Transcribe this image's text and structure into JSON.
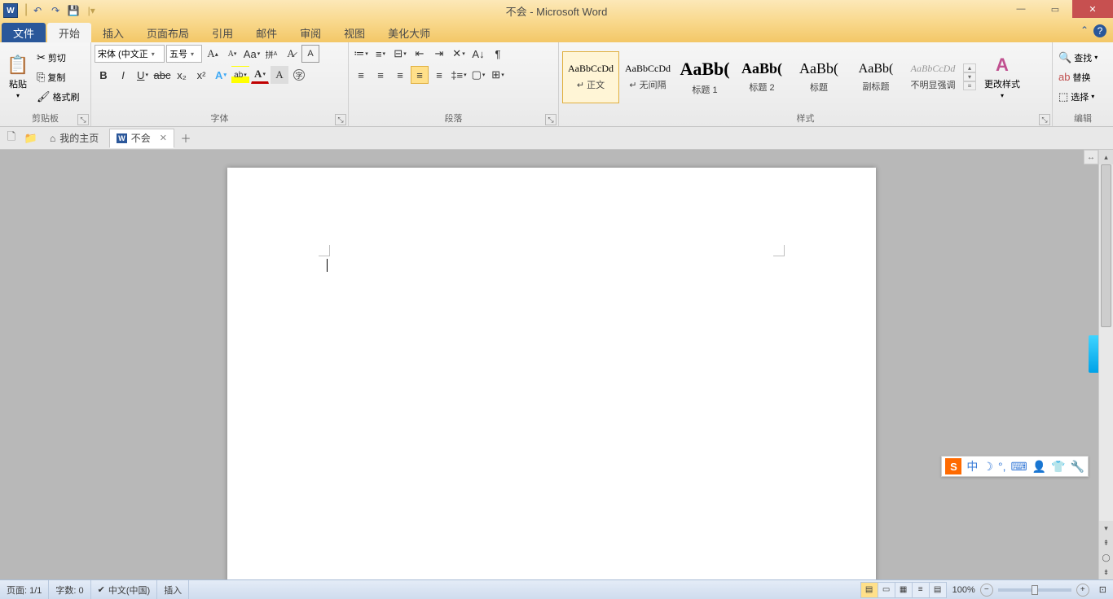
{
  "title": "不会 - Microsoft Word",
  "qat": {
    "undo": "↶",
    "redo": "↷",
    "save": "💾"
  },
  "win": {
    "min": "—",
    "max": "▭",
    "close": "✕"
  },
  "tabs": {
    "file": "文件",
    "items": [
      "开始",
      "插入",
      "页面布局",
      "引用",
      "邮件",
      "审阅",
      "视图",
      "美化大师"
    ],
    "active": 0
  },
  "ribbon": {
    "clipboard": {
      "label": "剪贴板",
      "paste": "粘贴",
      "cut": "剪切",
      "copy": "复制",
      "format_painter": "格式刷"
    },
    "font": {
      "label": "字体",
      "name": "宋体 (中文正",
      "size": "五号"
    },
    "paragraph": {
      "label": "段落"
    },
    "styles": {
      "label": "样式",
      "change": "更改样式",
      "items": [
        {
          "preview": "AaBbCcDd",
          "name": "↵ 正文",
          "size": "12px",
          "active": true
        },
        {
          "preview": "AaBbCcDd",
          "name": "↵ 无间隔",
          "size": "12px"
        },
        {
          "preview": "AaBb(",
          "name": "标题 1",
          "size": "22px",
          "bold": true
        },
        {
          "preview": "AaBb(",
          "name": "标题 2",
          "size": "18px",
          "bold": true
        },
        {
          "preview": "AaBb(",
          "name": "标题",
          "size": "18px"
        },
        {
          "preview": "AaBb(",
          "name": "副标题",
          "size": "16px"
        },
        {
          "preview": "AaBbCcDd",
          "name": "不明显强调",
          "size": "12px",
          "italic": true,
          "gray": true
        }
      ]
    },
    "editing": {
      "label": "编辑",
      "find": "查找",
      "replace": "替换",
      "select": "选择"
    }
  },
  "doctabs": {
    "home": "我的主页",
    "doc": "不会"
  },
  "ime": {
    "lang": "中"
  },
  "status": {
    "page": "页面: 1/1",
    "words": "字数: 0",
    "lang": "中文(中国)",
    "mode": "插入",
    "zoom": "100%"
  }
}
